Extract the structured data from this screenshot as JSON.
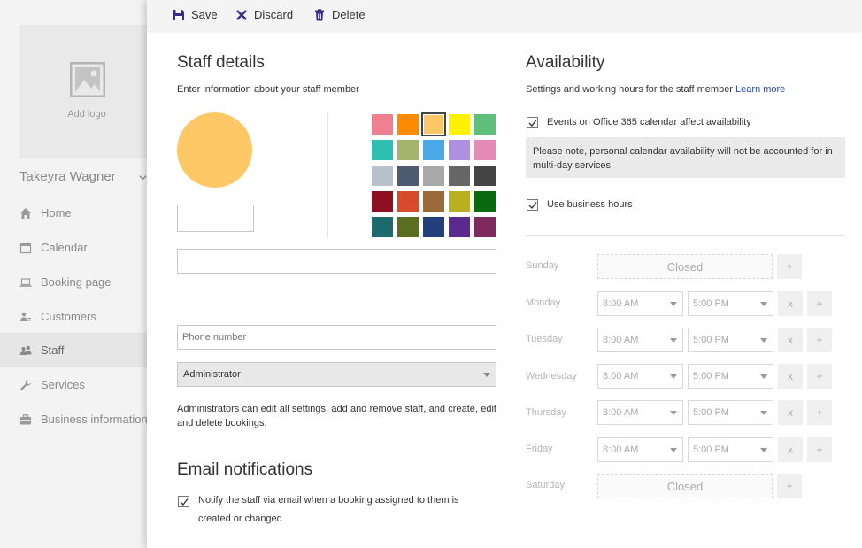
{
  "sidebar": {
    "logo_text": "Add logo",
    "user_name": "Takeyra Wagner",
    "items": [
      {
        "label": "Home",
        "icon": "home-icon"
      },
      {
        "label": "Calendar",
        "icon": "calendar-icon"
      },
      {
        "label": "Booking page",
        "icon": "laptop-icon"
      },
      {
        "label": "Customers",
        "icon": "customers-icon"
      },
      {
        "label": "Staff",
        "icon": "staff-icon",
        "active": true
      },
      {
        "label": "Services",
        "icon": "wrench-icon"
      },
      {
        "label": "Business information",
        "icon": "briefcase-icon"
      }
    ]
  },
  "toolbar": {
    "save_label": "Save",
    "discard_label": "Discard",
    "delete_label": "Delete"
  },
  "staff": {
    "title": "Staff details",
    "subtitle": "Enter information about your staff member",
    "avatar_color": "#ffc866",
    "initials_value": "",
    "name_value": "",
    "phone_placeholder": "Phone number",
    "role_selected": "Administrator",
    "role_description": "Administrators can edit all settings, add and remove staff, and create, edit and delete bookings.",
    "swatches": [
      "#f08090",
      "#ff8c00",
      "#ffc866",
      "#fff100",
      "#5dbf7a",
      "#2fbfb0",
      "#a4b46a",
      "#4aa8e8",
      "#ae90e0",
      "#e88ab8",
      "#b9c2cc",
      "#4d5a70",
      "#a8a8a8",
      "#666666",
      "#444444",
      "#8f0f20",
      "#d64c2a",
      "#9a6a3a",
      "#b8b020",
      "#0a6a10",
      "#1a6a6e",
      "#5a6e20",
      "#23407a",
      "#5a2a8e",
      "#7e2a5e"
    ],
    "selected_swatch": 2
  },
  "email": {
    "title": "Email notifications",
    "notify_label_line1": "Notify the staff via email when a booking assigned to them is",
    "notify_label_line2": "created or changed",
    "notify_checked": true
  },
  "availability": {
    "title": "Availability",
    "subtitle": "Settings and working hours for the staff member",
    "learn_more": "Learn more",
    "o365_label": "Events on Office 365 calendar affect availability",
    "o365_checked": true,
    "note": "Please note, personal calendar availability will not be accounted for in multi-day services.",
    "business_hours_label": "Use business hours",
    "business_hours_checked": true,
    "closed_label": "Closed",
    "remove_symbol": "x",
    "add_symbol": "+",
    "days": [
      {
        "name": "Sunday",
        "closed": true
      },
      {
        "name": "Monday",
        "start": "8:00 AM",
        "end": "5:00 PM"
      },
      {
        "name": "Tuesday",
        "start": "8:00 AM",
        "end": "5:00 PM"
      },
      {
        "name": "Wednesday",
        "start": "8:00 AM",
        "end": "5:00 PM"
      },
      {
        "name": "Thursday",
        "start": "8:00 AM",
        "end": "5:00 PM"
      },
      {
        "name": "Friday",
        "start": "8:00 AM",
        "end": "5:00 PM"
      },
      {
        "name": "Saturday",
        "closed": true
      }
    ]
  }
}
